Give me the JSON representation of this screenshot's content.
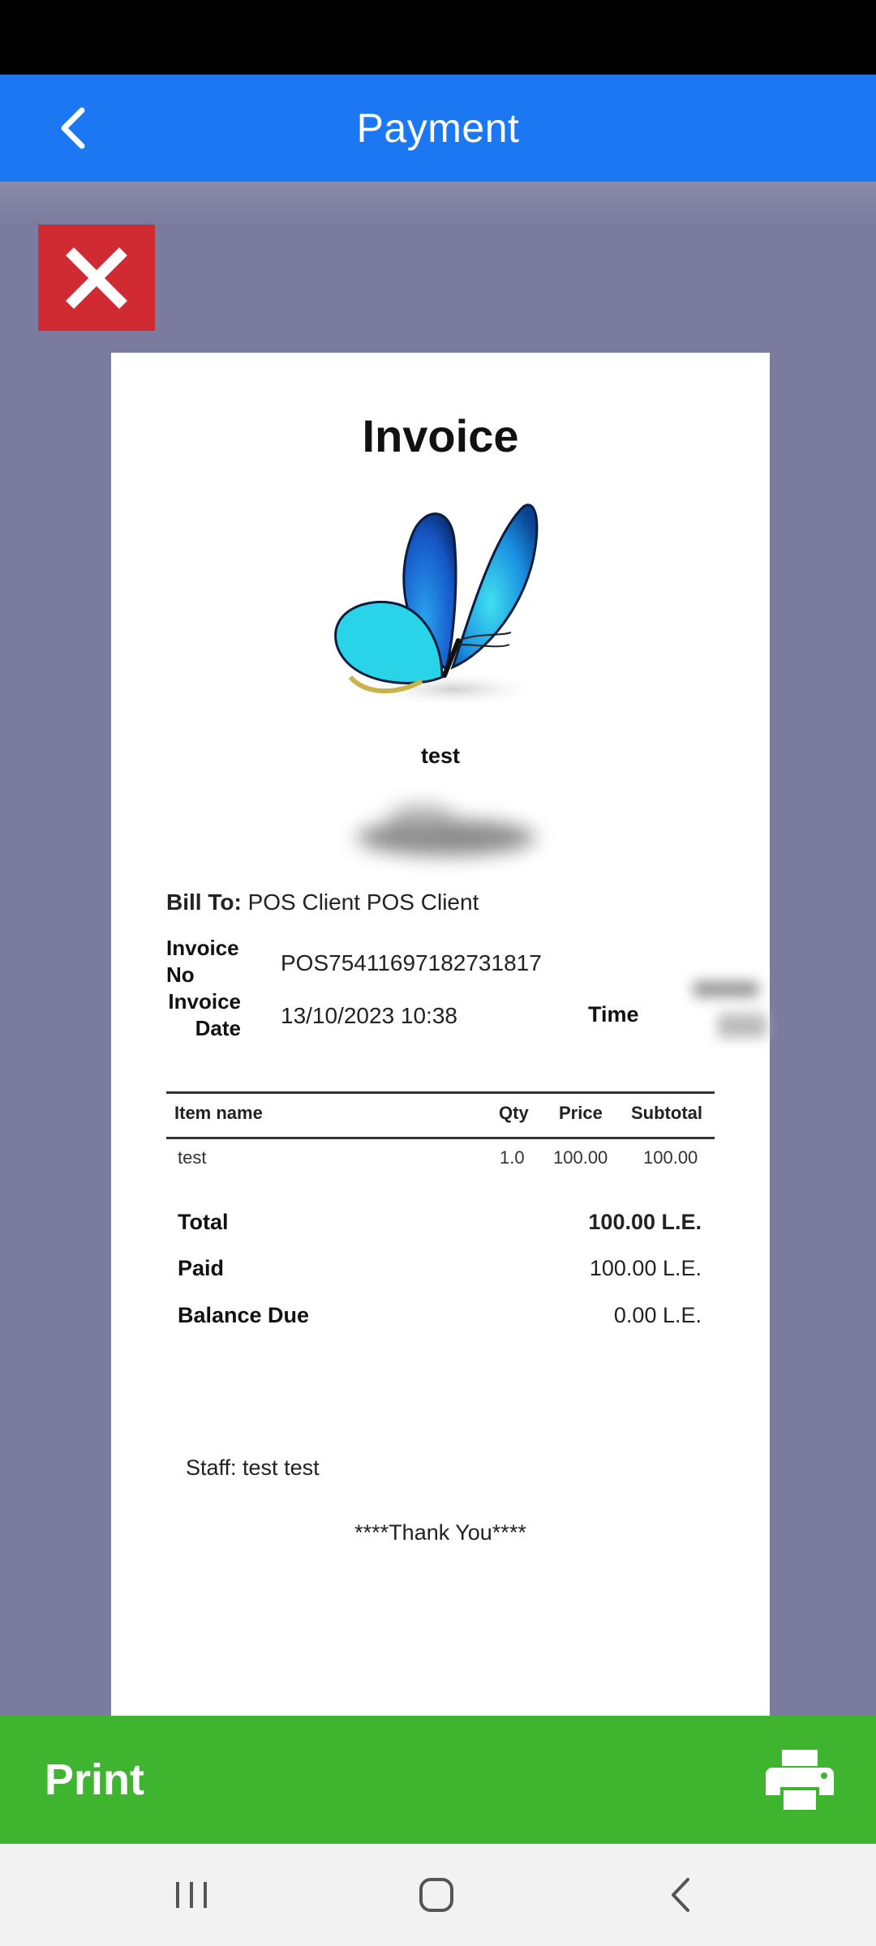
{
  "app_bar": {
    "title": "Payment"
  },
  "invoice": {
    "title": "Invoice",
    "shop_name": "test",
    "bill_to_label": "Bill To:",
    "bill_to_value": "POS Client POS Client",
    "invoice_no_label_1": "Invoice",
    "invoice_no_label_2": "No",
    "invoice_no": "POS75411697182731817",
    "invoice_date_label_1": "Invoice",
    "invoice_date_label_2": "Date",
    "invoice_date": "13/10/2023 10:38",
    "time_label": "Time",
    "table": {
      "headers": {
        "item": "Item name",
        "qty": "Qty",
        "price": "Price",
        "subtotal": "Subtotal"
      },
      "rows": [
        {
          "item": "test",
          "qty": "1.0",
          "price": "100.00",
          "subtotal": "100.00"
        }
      ]
    },
    "totals": {
      "total_label": "Total",
      "total_value": "100.00 L.E.",
      "paid_label": "Paid",
      "paid_value": "100.00 L.E.",
      "balance_label": "Balance Due",
      "balance_value": "0.00 L.E."
    },
    "staff": "Staff: test test",
    "thanks": "****Thank You****"
  },
  "print_bar": {
    "label": "Print"
  },
  "icons": {
    "back": "chevron-left-icon",
    "close": "close-icon",
    "logo": "butterfly-logo",
    "print": "printer-icon",
    "nav_recents": "recents-icon",
    "nav_home": "home-icon",
    "nav_back": "nav-back-icon"
  },
  "colors": {
    "app_bar": "#1b78f2",
    "overlay": "#7a7b9f",
    "close": "#d02a33",
    "print_bar": "#3fb42f"
  }
}
